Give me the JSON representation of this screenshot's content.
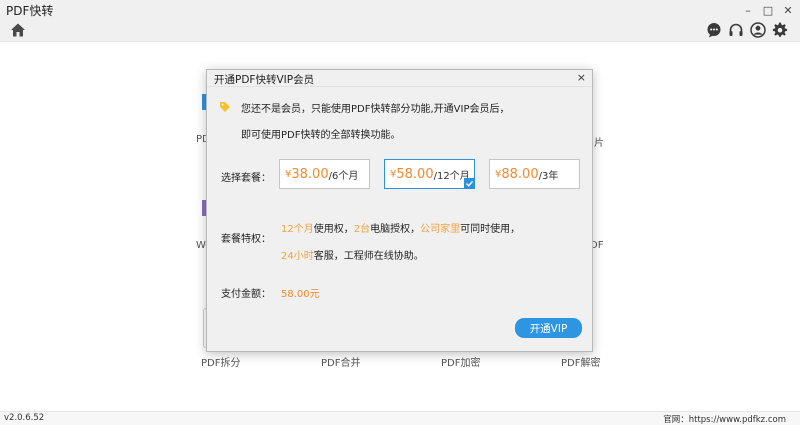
{
  "app": {
    "title": "PDF快转"
  },
  "window_controls": {
    "minimize": "–",
    "maximize": "□",
    "close": "✕"
  },
  "toolbar": {
    "icons": [
      "home-icon",
      "chat-icon",
      "headset-icon",
      "user-icon",
      "gear-icon"
    ]
  },
  "grid": {
    "labels": {
      "r1_left": "PDI",
      "r1_right": "片",
      "r2_left": "Wo",
      "r2_right": "DF",
      "r3_1": "PDF拆分",
      "r3_2": "PDF合并",
      "r3_3": "PDF加密",
      "r3_4": "PDF解密"
    },
    "accent_colors": {
      "blue": "#2e95e3",
      "purple": "#8a6cc0"
    }
  },
  "dialog": {
    "title": "开通PDF快转VIP会员",
    "close": "×",
    "notice_line1": "您还不是会员，只能使用PDF快转部分功能,开通VIP会员后，",
    "notice_line2": "即可使用PDF快转的全部转换功能。",
    "plan_label": "选择套餐：",
    "plans": [
      {
        "currency": "¥",
        "price": "38.00",
        "period": "/6个月",
        "selected": false
      },
      {
        "currency": "¥",
        "price": "58.00",
        "period": "/12个月",
        "selected": true
      },
      {
        "currency": "¥",
        "price": "88.00",
        "period": "/3年",
        "selected": false
      }
    ],
    "features_label": "套餐特权：",
    "features": {
      "f1_highlight": "12个月",
      "f1_text": "使用权，",
      "f2_highlight": "2台",
      "f2_text": "电脑授权，",
      "f3_highlight": "公司家里",
      "f3_text": "可同时使用，",
      "f4_highlight": "24小时",
      "f4_text": "客服，工程师在线协助。"
    },
    "payment_label": "支付金额：",
    "payment_amount": "58.00元",
    "submit_label": "开通VIP"
  },
  "statusbar": {
    "version": "v2.0.6.52",
    "website": "官网：https://www.pdfkz.com"
  },
  "colors": {
    "accent": "#2e95e3",
    "price": "#f08a2c",
    "highlight": "#f0a341"
  }
}
